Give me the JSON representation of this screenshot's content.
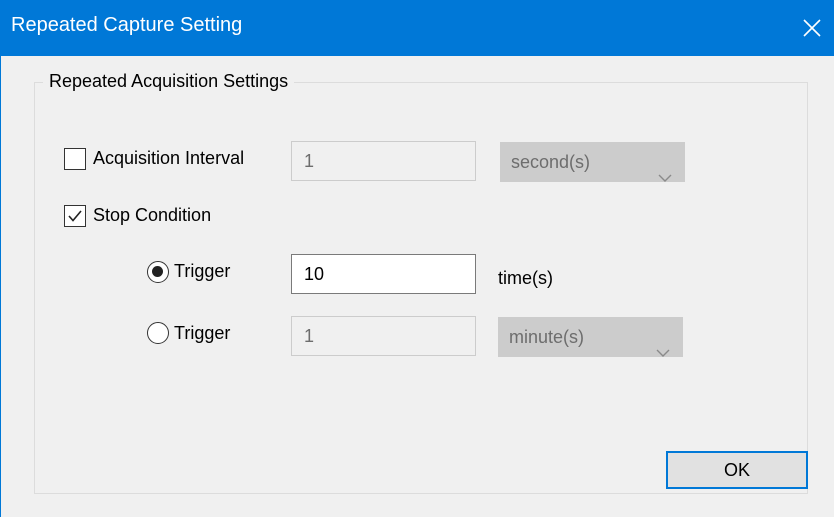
{
  "window": {
    "title": "Repeated Capture Setting"
  },
  "group": {
    "legend": "Repeated Acquisition Settings"
  },
  "acquisition_interval": {
    "label": "Acquisition Interval",
    "checked": false,
    "value": "1",
    "unit_selected": "second(s)"
  },
  "stop_condition": {
    "label": "Stop Condition",
    "checked": true
  },
  "trigger_count": {
    "label": "Trigger",
    "selected": true,
    "value": "10",
    "unit_label": "time(s)"
  },
  "trigger_time": {
    "label": "Trigger",
    "selected": false,
    "value": "1",
    "unit_selected": "minute(s)"
  },
  "buttons": {
    "ok": "OK"
  },
  "colors": {
    "title_bar": "#0078d7",
    "background": "#f0f0f0",
    "focus_border": "#0078d7"
  },
  "icons": {
    "close": "close-icon",
    "check": "check-icon",
    "chevron": "chevron-down-icon"
  }
}
